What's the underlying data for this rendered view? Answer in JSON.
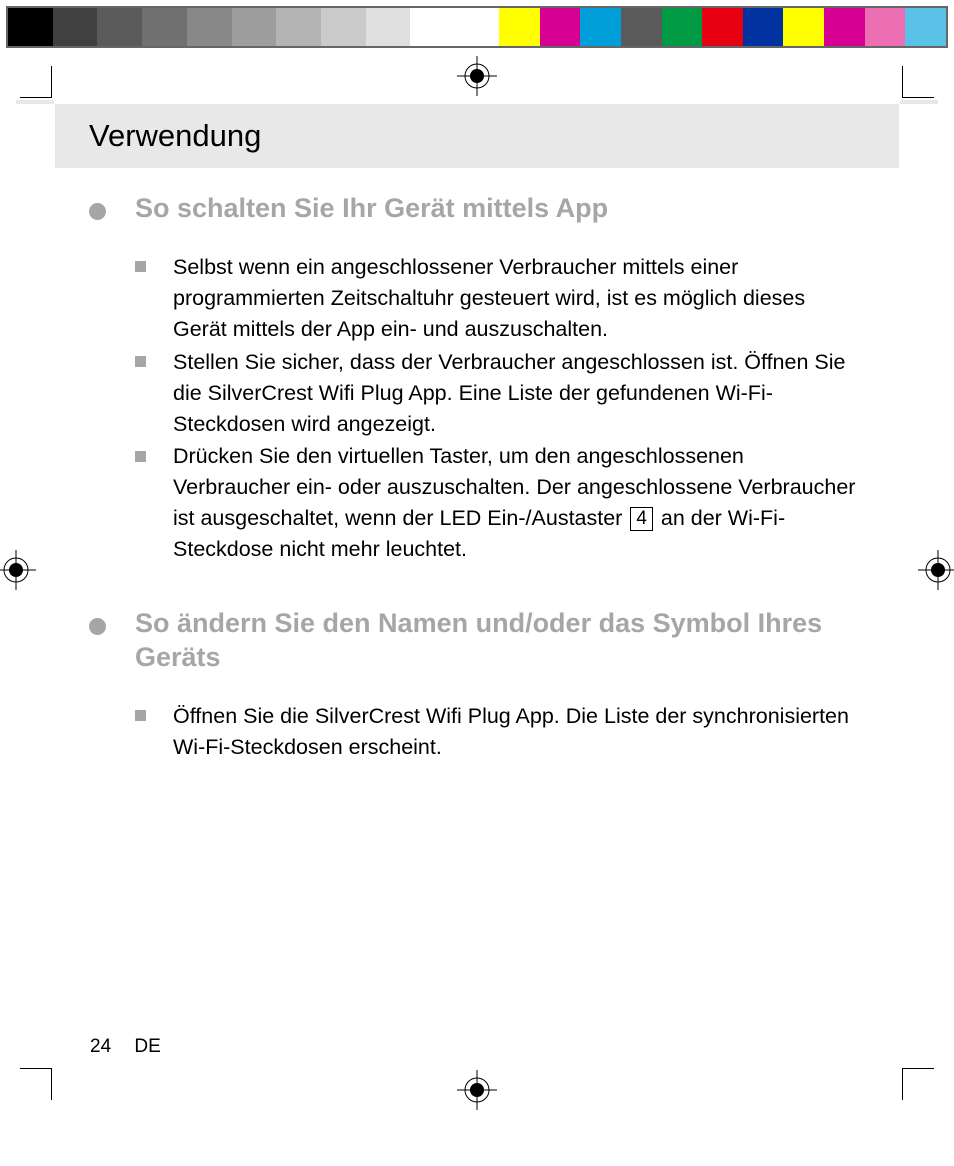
{
  "color_strip": {
    "left": [
      "#000000",
      "#404040",
      "#5a5a5a",
      "#707070",
      "#888888",
      "#9e9e9e",
      "#b4b4b4",
      "#cacaca",
      "#e0e0e0",
      "#ffffff"
    ],
    "right": [
      "#ffff00",
      "#d60093",
      "#009fda",
      "#5a5a5a",
      "#009944",
      "#e60012",
      "#0033a0",
      "#ffff00",
      "#d60093",
      "#ec6fb3",
      "#5bc2e7"
    ]
  },
  "header": {
    "title": "Verwendung"
  },
  "sections": [
    {
      "heading": "So schalten Sie Ihr Gerät mittels App",
      "items": [
        {
          "text": "Selbst wenn ein angeschlossener Verbraucher mittels einer programmierten Zeitschaltuhr gesteuert wird, ist es möglich dieses Gerät mittels der App ein- und auszuschalten."
        },
        {
          "text": "Stellen Sie sicher, dass der Verbraucher angeschlossen ist. Öffnen Sie die SilverCrest Wifi Plug App. Eine Liste der gefundenen Wi-Fi-Steckdosen wird angezeigt."
        },
        {
          "text_before": "Drücken Sie den virtuellen Taster, um den angeschlossenen Verbraucher ein- oder auszuschalten. Der angeschlossene Verbraucher ist ausgeschaltet, wenn der LED Ein-/Austaster ",
          "ref": "4",
          "text_after": " an der Wi-Fi-Steckdose nicht mehr leuchtet."
        }
      ]
    },
    {
      "heading": "So ändern Sie den Namen und/oder das Symbol Ihres Geräts",
      "items": [
        {
          "text": "Öffnen Sie die SilverCrest Wifi Plug App. Die Liste der synchronisierten Wi-Fi-Steckdosen erscheint."
        }
      ]
    }
  ],
  "footer": {
    "page_number": "24",
    "lang": "DE"
  }
}
